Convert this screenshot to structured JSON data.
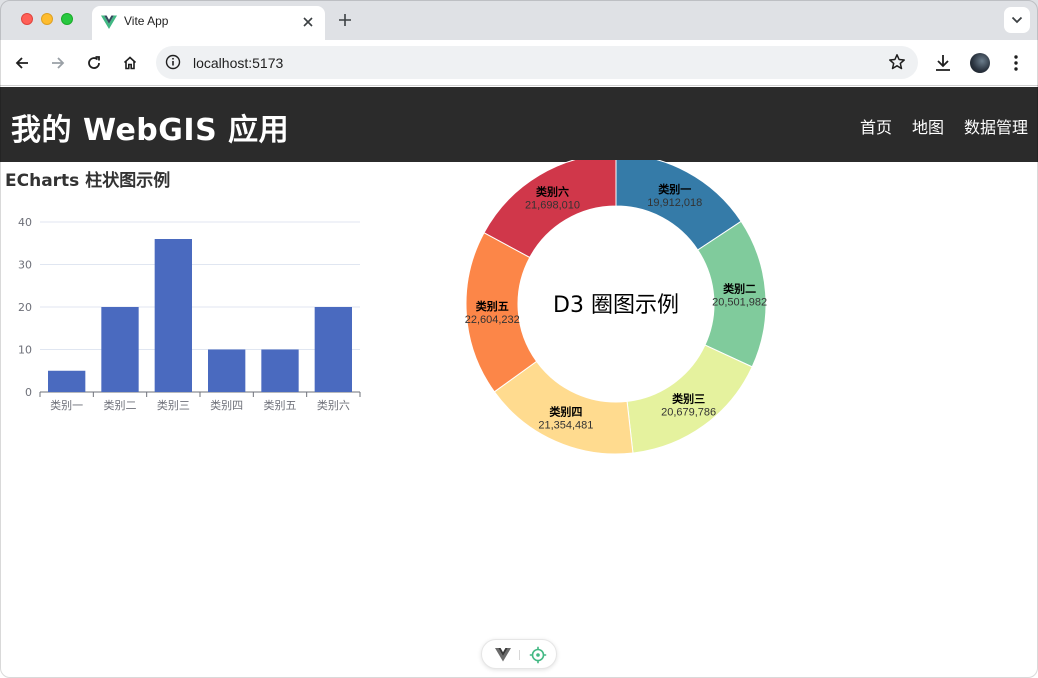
{
  "browser": {
    "tab_title": "Vite App",
    "url": "localhost:5173",
    "icons": [
      "vue-favicon-icon",
      "close-icon",
      "plus-icon",
      "chevron-down-icon",
      "back-arrow-icon",
      "forward-arrow-icon",
      "reload-icon",
      "home-icon",
      "info-icon",
      "star-icon",
      "download-icon",
      "kebab-menu-icon"
    ]
  },
  "header": {
    "title": "我的 WebGIS 应用",
    "nav": [
      "首页",
      "地图",
      "数据管理"
    ]
  },
  "bar_section": {
    "title": "ECharts 柱状图示例"
  },
  "donut_section": {
    "center_label": "D3 圈图示例"
  },
  "chart_data": [
    {
      "type": "bar",
      "title": "ECharts 柱状图示例",
      "categories": [
        "类别一",
        "类别二",
        "类别三",
        "类别四",
        "类别五",
        "类别六"
      ],
      "values": [
        5,
        20,
        36,
        10,
        10,
        20
      ],
      "yticks": [
        "0",
        "10",
        "20",
        "30",
        "40"
      ],
      "ylim": [
        0,
        40
      ],
      "grid": true,
      "color": "#4a6abf"
    },
    {
      "type": "pie",
      "subtype": "donut",
      "title": "D3 圈图示例",
      "labels": [
        "类别一",
        "类别二",
        "类别三",
        "类别四",
        "类别五",
        "类别六"
      ],
      "values": [
        19912018,
        20501982,
        20679786,
        21354481,
        22604232,
        21698010
      ],
      "value_labels": [
        "19,912,018",
        "20,501,982",
        "20,679,786",
        "21,354,481",
        "22,604,232",
        "21,698,010"
      ],
      "colors": [
        "#357ba8",
        "#80cb9c",
        "#e5f29e",
        "#ffdb8f",
        "#fc8648",
        "#d0374a"
      ]
    }
  ],
  "devtools": {
    "icons": [
      "vue-logo-icon",
      "crosshair-icon"
    ]
  }
}
